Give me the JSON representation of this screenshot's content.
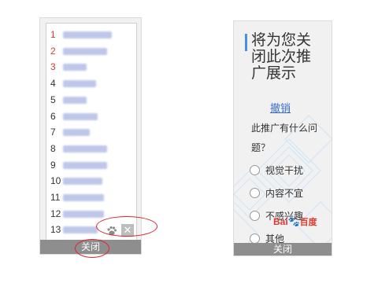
{
  "left_panel": {
    "rows": [
      {
        "num": "1",
        "num_red": true,
        "link_len": 62
      },
      {
        "num": "2",
        "num_red": true,
        "link_len": 56
      },
      {
        "num": "3",
        "num_red": true,
        "link_len": 30
      },
      {
        "num": "4",
        "num_red": false,
        "link_len": 42
      },
      {
        "num": "5",
        "num_red": false,
        "link_len": 30
      },
      {
        "num": "6",
        "num_red": false,
        "link_len": 44
      },
      {
        "num": "7",
        "num_red": false,
        "link_len": 34
      },
      {
        "num": "8",
        "num_red": false,
        "link_len": 56
      },
      {
        "num": "9",
        "num_red": false,
        "link_len": 56
      },
      {
        "num": "10",
        "num_red": false,
        "link_len": 50
      },
      {
        "num": "11",
        "num_red": false,
        "link_len": 52
      },
      {
        "num": "12",
        "num_red": false,
        "link_len": 52
      },
      {
        "num": "13",
        "num_red": false,
        "link_len": 44
      }
    ],
    "close_label": "关闭",
    "close_x_glyph": "✕",
    "icons": [
      "paw-icon",
      "close-icon"
    ],
    "highlight_color": "#e0232c"
  },
  "right_panel": {
    "title": "将为您关闭此次推广展示",
    "undo_label": "撤销",
    "question": "此推广有什么问题？",
    "options": [
      "视觉干扰",
      "内容不宜",
      "不感兴趣",
      "其他"
    ],
    "logo": {
      "part1": "Bai",
      "paw": "🐾",
      "part2": "百度"
    },
    "close_label": "关闭"
  },
  "colors": {
    "red": "#e23a2f",
    "link": "#3b6bd1",
    "bar": "#8e8e8e",
    "accent": "#4a90e2"
  }
}
